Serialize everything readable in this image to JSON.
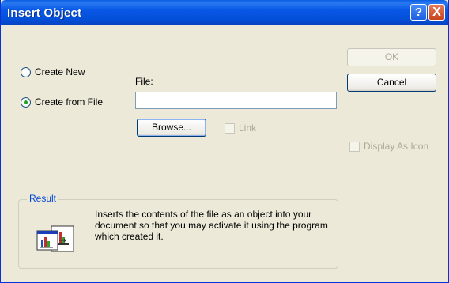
{
  "dialog": {
    "title": "Insert Object",
    "help_button": "?",
    "close_button": "X"
  },
  "options": {
    "create_new": "Create New",
    "create_from_file": "Create from File",
    "selected": "create_from_file"
  },
  "file": {
    "label": "File:",
    "value": "",
    "browse_label": "Browse...",
    "link_label": "Link"
  },
  "buttons": {
    "ok": "OK",
    "cancel": "Cancel"
  },
  "display_as_icon": "Display As Icon",
  "result": {
    "title": "Result",
    "text": "Inserts the contents of the file as an object into your document so that you may activate it using the program which created it."
  }
}
